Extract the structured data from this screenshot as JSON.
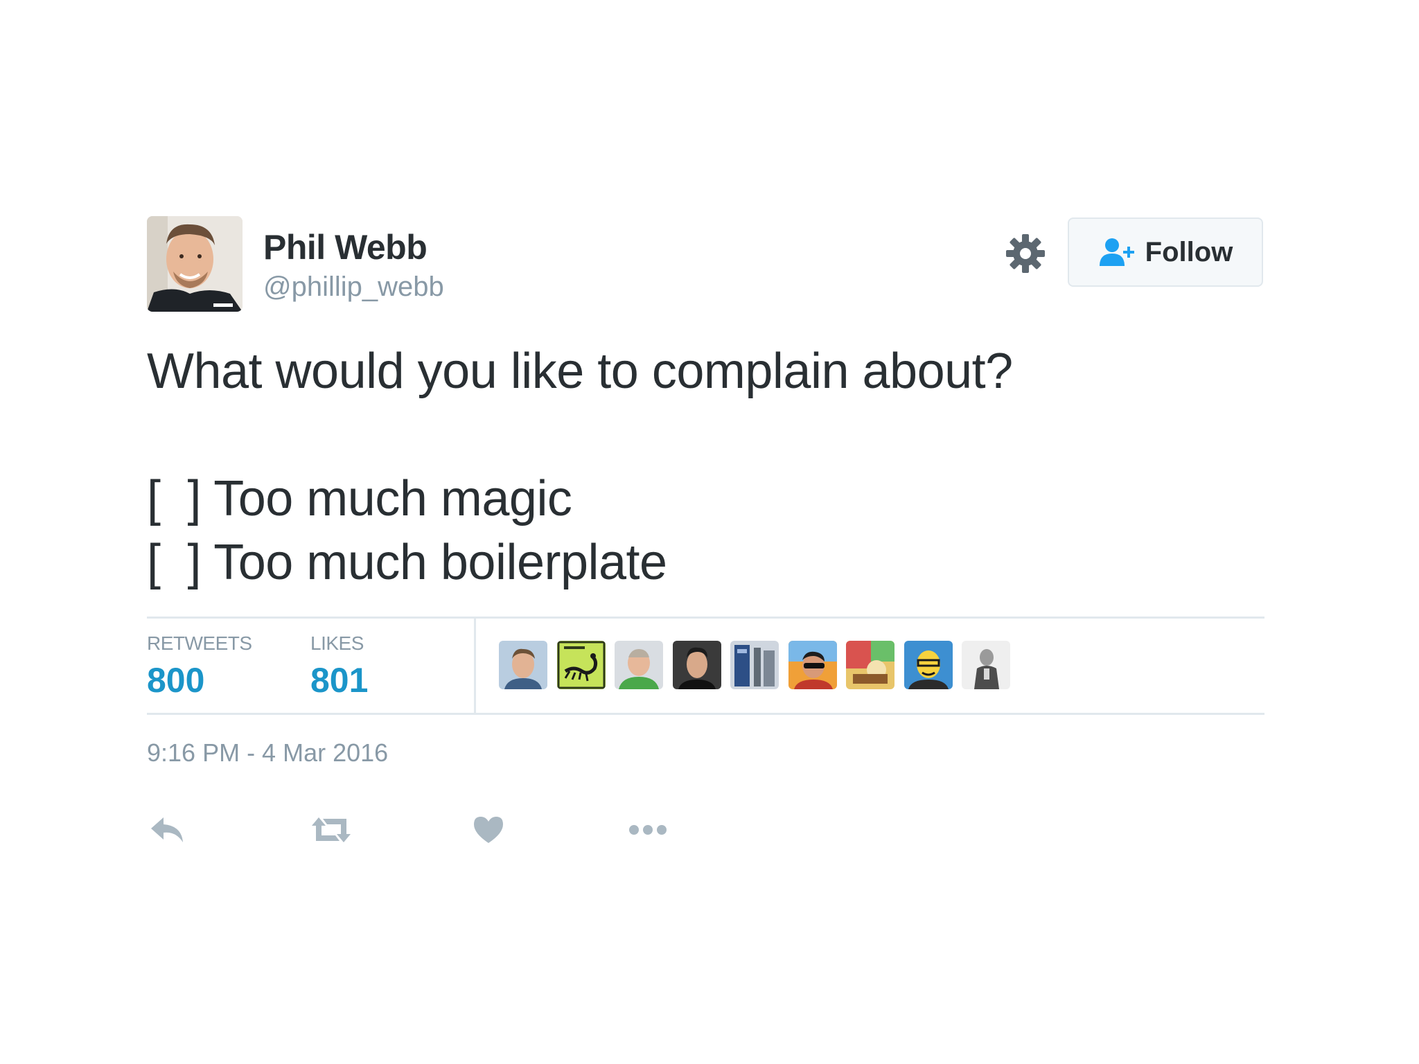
{
  "user": {
    "name": "Phil Webb",
    "handle": "@phillip_webb"
  },
  "header": {
    "follow_label": "Follow"
  },
  "tweet": {
    "question": "What would you like to complain about?",
    "options": [
      "[  ] Too much magic",
      "[  ] Too much boilerplate"
    ]
  },
  "stats": {
    "retweets_label": "RETWEETS",
    "retweets_value": "800",
    "likes_label": "LIKES",
    "likes_value": "801"
  },
  "timestamp": "9:16 PM - 4 Mar 2016",
  "colors": {
    "text": "#292f33",
    "muted": "#8899a6",
    "accent": "#1b95c9",
    "border": "#e1e8ed",
    "follow_icon": "#1da1f2"
  },
  "icons": {
    "settings": "gear-icon",
    "follow": "add-user-icon",
    "reply": "reply-icon",
    "retweet": "retweet-icon",
    "like": "heart-icon",
    "more": "more-icon"
  }
}
